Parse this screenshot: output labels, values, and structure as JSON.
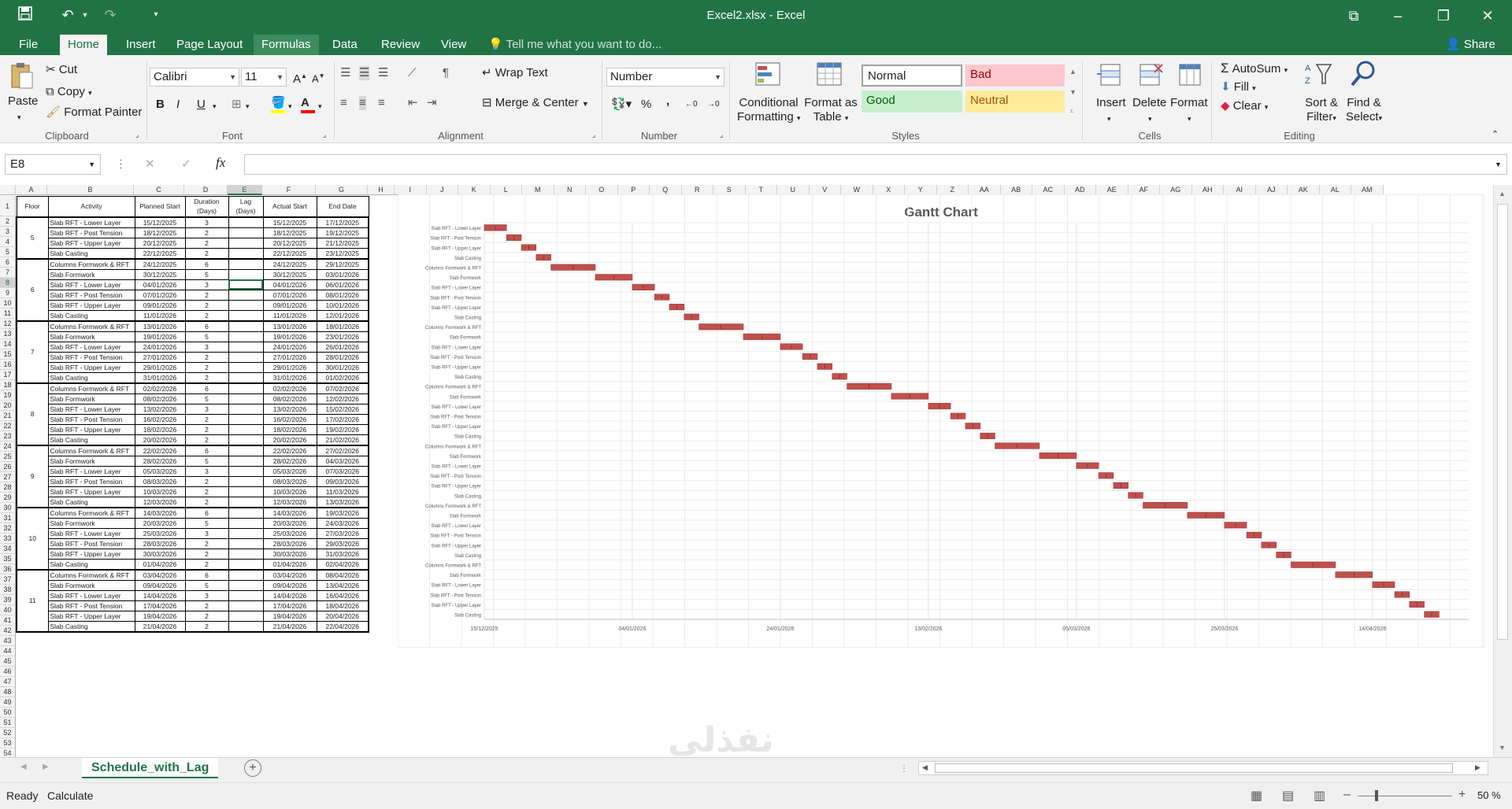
{
  "window": {
    "title": "Excel2.xlsx - Excel"
  },
  "tabs": [
    {
      "label": "File"
    },
    {
      "label": "Home"
    },
    {
      "label": "Insert"
    },
    {
      "label": "Page Layout"
    },
    {
      "label": "Formulas"
    },
    {
      "label": "Data"
    },
    {
      "label": "Review"
    },
    {
      "label": "View"
    }
  ],
  "tellme": {
    "placeholder": "Tell me what you want to do..."
  },
  "share": {
    "label": "Share"
  },
  "ribbon": {
    "clipboard": {
      "label": "Clipboard",
      "paste": "Paste",
      "cut": "Cut",
      "copy": "Copy",
      "format_painter": "Format Painter"
    },
    "font": {
      "label": "Font",
      "name": "Calibri",
      "size": "11",
      "bold": "B",
      "italic": "I",
      "underline": "U"
    },
    "alignment": {
      "label": "Alignment",
      "wrap": "Wrap Text",
      "merge": "Merge & Center"
    },
    "number": {
      "label": "Number",
      "format": "Number",
      "percent": "%",
      "comma": ","
    },
    "styles": {
      "label": "Styles",
      "conditional": "Conditional",
      "conditional2": "Formatting",
      "format_as": "Format as",
      "format_as2": "Table",
      "normal": "Normal",
      "bad": "Bad",
      "good": "Good",
      "neutral": "Neutral"
    },
    "cells": {
      "label": "Cells",
      "insert": "Insert",
      "delete": "Delete",
      "format": "Format"
    },
    "editing": {
      "label": "Editing",
      "autosum": "AutoSum",
      "fill": "Fill",
      "clear": "Clear",
      "sort": "Sort &",
      "sort2": "Filter",
      "find": "Find &",
      "find2": "Select"
    }
  },
  "formula_bar": {
    "name_box": "E8",
    "value": ""
  },
  "columns": [
    "A",
    "B",
    "C",
    "D",
    "E",
    "F",
    "G",
    "H",
    "I",
    "J",
    "K",
    "L",
    "M",
    "N",
    "O",
    "P",
    "Q",
    "R",
    "S",
    "T",
    "U",
    "V",
    "W",
    "X",
    "Y",
    "Z",
    "AA",
    "AB",
    "AC",
    "AD",
    "AE",
    "AF",
    "AG",
    "AH",
    "AI",
    "AJ",
    "AK",
    "AL",
    "AM"
  ],
  "table": {
    "headers": [
      "Floor",
      "Activity",
      "Planned Start",
      "Duration (Days)",
      "Lag (Days)",
      "Actual Start",
      "End Date"
    ],
    "floors": [
      {
        "floor": "5",
        "rows": [
          [
            "Slab RFT - Lower Layer",
            "15/12/2025",
            "3",
            "15/12/2025",
            "17/12/2025"
          ],
          [
            "Slab RFT - Post Tension",
            "18/12/2025",
            "2",
            "18/12/2025",
            "19/12/2025"
          ],
          [
            "Slab RFT - Upper Layer",
            "20/12/2025",
            "2",
            "20/12/2025",
            "21/12/2025"
          ],
          [
            "Slab Casting",
            "22/12/2025",
            "2",
            "22/12/2025",
            "23/12/2025"
          ]
        ]
      },
      {
        "floor": "6",
        "rows": [
          [
            "Columns Formwork & RFT",
            "24/12/2025",
            "6",
            "24/12/2025",
            "29/12/2025"
          ],
          [
            "Slab Formwork",
            "30/12/2025",
            "5",
            "30/12/2025",
            "03/01/2026"
          ],
          [
            "Slab RFT - Lower Layer",
            "04/01/2026",
            "3",
            "04/01/2026",
            "06/01/2026"
          ],
          [
            "Slab RFT - Post Tension",
            "07/01/2026",
            "2",
            "07/01/2026",
            "08/01/2026"
          ],
          [
            "Slab RFT - Upper Layer",
            "09/01/2026",
            "2",
            "09/01/2026",
            "10/01/2026"
          ],
          [
            "Slab Casting",
            "11/01/2026",
            "2",
            "11/01/2026",
            "12/01/2026"
          ]
        ]
      },
      {
        "floor": "7",
        "rows": [
          [
            "Columns Formwork & RFT",
            "13/01/2026",
            "6",
            "13/01/2026",
            "18/01/2026"
          ],
          [
            "Slab Formwork",
            "19/01/2026",
            "5",
            "19/01/2026",
            "23/01/2026"
          ],
          [
            "Slab RFT - Lower Layer",
            "24/01/2026",
            "3",
            "24/01/2026",
            "26/01/2026"
          ],
          [
            "Slab RFT - Post Tension",
            "27/01/2026",
            "2",
            "27/01/2026",
            "28/01/2026"
          ],
          [
            "Slab RFT - Upper Layer",
            "29/01/2026",
            "2",
            "29/01/2026",
            "30/01/2026"
          ],
          [
            "Slab Casting",
            "31/01/2026",
            "2",
            "31/01/2026",
            "01/02/2026"
          ]
        ]
      },
      {
        "floor": "8",
        "rows": [
          [
            "Columns Formwork & RFT",
            "02/02/2026",
            "6",
            "02/02/2026",
            "07/02/2026"
          ],
          [
            "Slab Formwork",
            "08/02/2026",
            "5",
            "08/02/2026",
            "12/02/2026"
          ],
          [
            "Slab RFT - Lower Layer",
            "13/02/2026",
            "3",
            "13/02/2026",
            "15/02/2026"
          ],
          [
            "Slab RFT - Post Tension",
            "16/02/2026",
            "2",
            "16/02/2026",
            "17/02/2026"
          ],
          [
            "Slab RFT - Upper Layer",
            "18/02/2026",
            "2",
            "18/02/2026",
            "19/02/2026"
          ],
          [
            "Slab Casting",
            "20/02/2026",
            "2",
            "20/02/2026",
            "21/02/2026"
          ]
        ]
      },
      {
        "floor": "9",
        "rows": [
          [
            "Columns Formwork & RFT",
            "22/02/2026",
            "6",
            "22/02/2026",
            "27/02/2026"
          ],
          [
            "Slab Formwork",
            "28/02/2026",
            "5",
            "28/02/2026",
            "04/03/2026"
          ],
          [
            "Slab RFT - Lower Layer",
            "05/03/2026",
            "3",
            "05/03/2026",
            "07/03/2026"
          ],
          [
            "Slab RFT - Post Tension",
            "08/03/2026",
            "2",
            "08/03/2026",
            "09/03/2026"
          ],
          [
            "Slab RFT - Upper Layer",
            "10/03/2026",
            "2",
            "10/03/2026",
            "11/03/2026"
          ],
          [
            "Slab Casting",
            "12/03/2026",
            "2",
            "12/03/2026",
            "13/03/2026"
          ]
        ]
      },
      {
        "floor": "10",
        "rows": [
          [
            "Columns Formwork & RFT",
            "14/03/2026",
            "6",
            "14/03/2026",
            "19/03/2026"
          ],
          [
            "Slab Formwork",
            "20/03/2026",
            "5",
            "20/03/2026",
            "24/03/2026"
          ],
          [
            "Slab RFT - Lower Layer",
            "25/03/2026",
            "3",
            "25/03/2026",
            "27/03/2026"
          ],
          [
            "Slab RFT - Post Tension",
            "28/03/2026",
            "2",
            "28/03/2026",
            "29/03/2026"
          ],
          [
            "Slab RFT - Upper Layer",
            "30/03/2026",
            "2",
            "30/03/2026",
            "31/03/2026"
          ],
          [
            "Slab Casting",
            "01/04/2026",
            "2",
            "01/04/2026",
            "02/04/2026"
          ]
        ]
      },
      {
        "floor": "11",
        "rows": [
          [
            "Columns Formwork & RFT",
            "03/04/2026",
            "6",
            "03/04/2026",
            "08/04/2026"
          ],
          [
            "Slab Formwork",
            "09/04/2026",
            "5",
            "09/04/2026",
            "13/04/2026"
          ],
          [
            "Slab RFT - Lower Layer",
            "14/04/2026",
            "3",
            "14/04/2026",
            "16/04/2026"
          ],
          [
            "Slab RFT - Post Tension",
            "17/04/2026",
            "2",
            "17/04/2026",
            "18/04/2026"
          ],
          [
            "Slab RFT - Upper Layer",
            "19/04/2026",
            "2",
            "19/04/2026",
            "20/04/2026"
          ],
          [
            "Slab Casting",
            "21/04/2026",
            "2",
            "21/04/2026",
            "22/04/2026"
          ]
        ]
      }
    ]
  },
  "chart_data": {
    "type": "bar",
    "title": "Gantt Chart",
    "orientation": "horizontal-gantt",
    "x_ticks": [
      "15/12/2025",
      "04/01/2026",
      "24/01/2026",
      "13/02/2026",
      "05/03/2026",
      "25/03/2026",
      "14/04/2026"
    ],
    "xlim": [
      "15/12/2025",
      "27/04/2026"
    ],
    "bar_color": "#c0504d",
    "series": [
      {
        "values": [
          {
            "task": "Slab RFT - Lower Layer",
            "start": "15/12/2025",
            "days": 3
          },
          {
            "task": "Slab RFT - Post Tension",
            "start": "18/12/2025",
            "days": 2
          },
          {
            "task": "Slab RFT - Upper Layer",
            "start": "20/12/2025",
            "days": 2
          },
          {
            "task": "Slab Casting",
            "start": "22/12/2025",
            "days": 2
          },
          {
            "task": "Columns Formwork & RFT",
            "start": "24/12/2025",
            "days": 6
          },
          {
            "task": "Slab Formwork",
            "start": "30/12/2025",
            "days": 5
          },
          {
            "task": "Slab RFT - Lower Layer",
            "start": "04/01/2026",
            "days": 3
          },
          {
            "task": "Slab RFT - Post Tension",
            "start": "07/01/2026",
            "days": 2
          },
          {
            "task": "Slab RFT - Upper Layer",
            "start": "09/01/2026",
            "days": 2
          },
          {
            "task": "Slab Casting",
            "start": "11/01/2026",
            "days": 2
          },
          {
            "task": "Columns Formwork & RFT",
            "start": "13/01/2026",
            "days": 6
          },
          {
            "task": "Slab Formwork",
            "start": "19/01/2026",
            "days": 5
          },
          {
            "task": "Slab RFT - Lower Layer",
            "start": "24/01/2026",
            "days": 3
          },
          {
            "task": "Slab RFT - Post Tension",
            "start": "27/01/2026",
            "days": 2
          },
          {
            "task": "Slab RFT - Upper Layer",
            "start": "29/01/2026",
            "days": 2
          },
          {
            "task": "Slab Casting",
            "start": "31/01/2026",
            "days": 2
          },
          {
            "task": "Columns Formwork & RFT",
            "start": "02/02/2026",
            "days": 6
          },
          {
            "task": "Slab Formwork",
            "start": "08/02/2026",
            "days": 5
          },
          {
            "task": "Slab RFT - Lower Layer",
            "start": "13/02/2026",
            "days": 3
          },
          {
            "task": "Slab RFT - Post Tension",
            "start": "16/02/2026",
            "days": 2
          },
          {
            "task": "Slab RFT - Upper Layer",
            "start": "18/02/2026",
            "days": 2
          },
          {
            "task": "Slab Casting",
            "start": "20/02/2026",
            "days": 2
          },
          {
            "task": "Columns Formwork & RFT",
            "start": "22/02/2026",
            "days": 6
          },
          {
            "task": "Slab Formwork",
            "start": "28/02/2026",
            "days": 5
          },
          {
            "task": "Slab RFT - Lower Layer",
            "start": "05/03/2026",
            "days": 3
          },
          {
            "task": "Slab RFT - Post Tension",
            "start": "08/03/2026",
            "days": 2
          },
          {
            "task": "Slab RFT - Upper Layer",
            "start": "10/03/2026",
            "days": 2
          },
          {
            "task": "Slab Casting",
            "start": "12/03/2026",
            "days": 2
          },
          {
            "task": "Columns Formwork & RFT",
            "start": "14/03/2026",
            "days": 6
          },
          {
            "task": "Slab Formwork",
            "start": "20/03/2026",
            "days": 5
          },
          {
            "task": "Slab RFT - Lower Layer",
            "start": "25/03/2026",
            "days": 3
          },
          {
            "task": "Slab RFT - Post Tension",
            "start": "28/03/2026",
            "days": 2
          },
          {
            "task": "Slab RFT - Upper Layer",
            "start": "30/03/2026",
            "days": 2
          },
          {
            "task": "Slab Casting",
            "start": "01/04/2026",
            "days": 2
          },
          {
            "task": "Columns Formwork & RFT",
            "start": "03/04/2026",
            "days": 6
          },
          {
            "task": "Slab Formwork",
            "start": "09/04/2026",
            "days": 5
          },
          {
            "task": "Slab RFT - Lower Layer",
            "start": "14/04/2026",
            "days": 3
          },
          {
            "task": "Slab RFT - Post Tension",
            "start": "17/04/2026",
            "days": 2
          },
          {
            "task": "Slab RFT - Upper Layer",
            "start": "19/04/2026",
            "days": 2
          },
          {
            "task": "Slab Casting",
            "start": "21/04/2026",
            "days": 2
          }
        ]
      }
    ]
  },
  "sheet_tab": {
    "label": "Schedule_with_Lag"
  },
  "status": {
    "ready": "Ready",
    "calculate": "Calculate",
    "zoom": "50 %"
  },
  "colors": {
    "accent": "#217346",
    "bad_bg": "#ffc7ce",
    "good_bg": "#c6efce",
    "neutral_bg": "#ffeb9c"
  },
  "icons": [
    "save-icon",
    "undo-icon",
    "redo-icon",
    "customize-icon",
    "ribbon-display-icon",
    "minimize-icon",
    "restore-icon",
    "close-icon",
    "lightbulb-icon",
    "share-icon",
    "new-sheet-icon",
    "normal-view-icon",
    "page-layout-icon",
    "page-break-icon"
  ]
}
